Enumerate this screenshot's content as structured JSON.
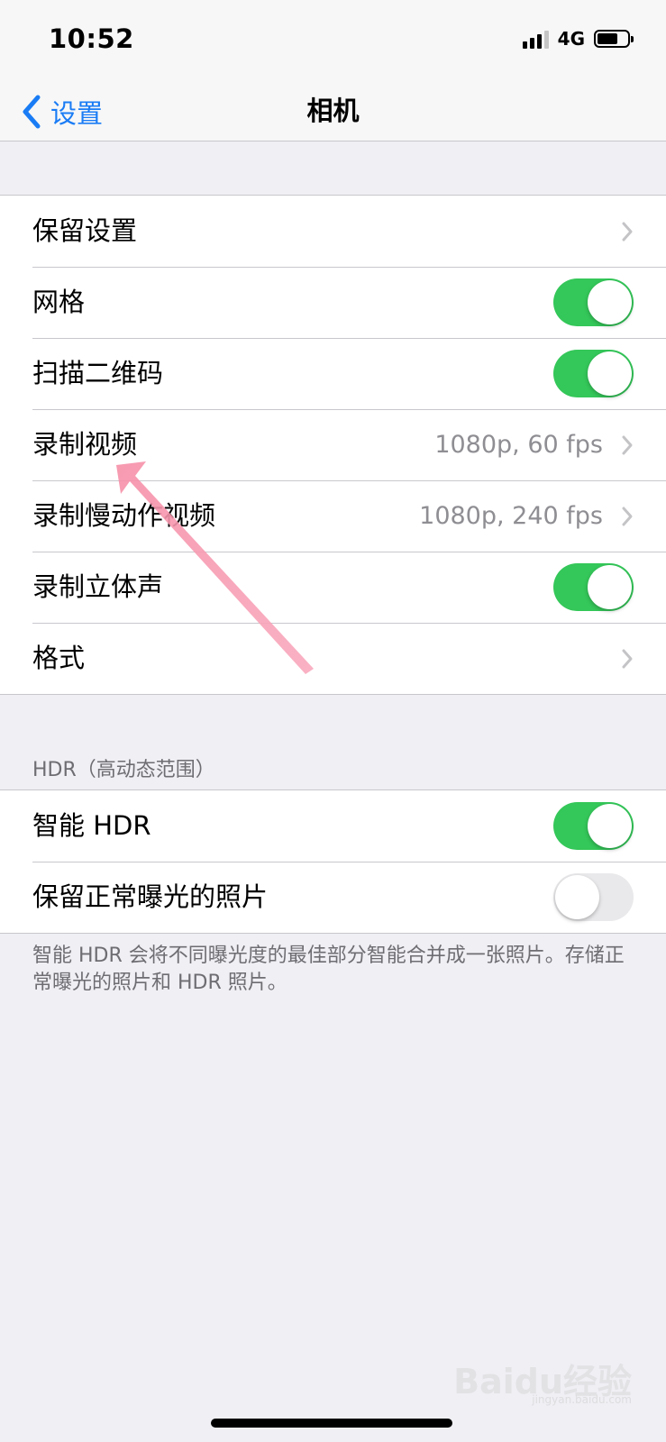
{
  "status_bar": {
    "time": "10:52",
    "network": "4G"
  },
  "nav": {
    "back_label": "设置",
    "title": "相机"
  },
  "group1": {
    "rows": [
      {
        "label": "保留设置",
        "type": "chevron"
      },
      {
        "label": "网格",
        "type": "toggle",
        "on": true
      },
      {
        "label": "扫描二维码",
        "type": "toggle",
        "on": true
      },
      {
        "label": "录制视频",
        "type": "chevron",
        "value": "1080p, 60 fps"
      },
      {
        "label": "录制慢动作视频",
        "type": "chevron",
        "value": "1080p, 240 fps"
      },
      {
        "label": "录制立体声",
        "type": "toggle",
        "on": true
      },
      {
        "label": "格式",
        "type": "chevron"
      }
    ]
  },
  "hdr_section": {
    "header": "HDR（高动态范围）",
    "rows": [
      {
        "label": "智能 HDR",
        "type": "toggle",
        "on": true
      },
      {
        "label": "保留正常曝光的照片",
        "type": "toggle",
        "on": false
      }
    ],
    "footer": "智能 HDR 会将不同曝光度的最佳部分智能合并成一张照片。存储正常曝光的照片和 HDR 照片。"
  },
  "watermark": {
    "logo": "Baidu经验",
    "site": "jingyan.baidu.com"
  },
  "colors": {
    "accent": "#1a7cf5",
    "toggle_on": "#34c759",
    "toggle_off": "#e9e9eb",
    "annotation_arrow": "#f68fa8",
    "background": "#efeff4"
  },
  "icons": {
    "back": "chevron-left-icon",
    "disclosure": "chevron-right-icon",
    "signal": "signal-icon",
    "battery": "battery-icon"
  }
}
